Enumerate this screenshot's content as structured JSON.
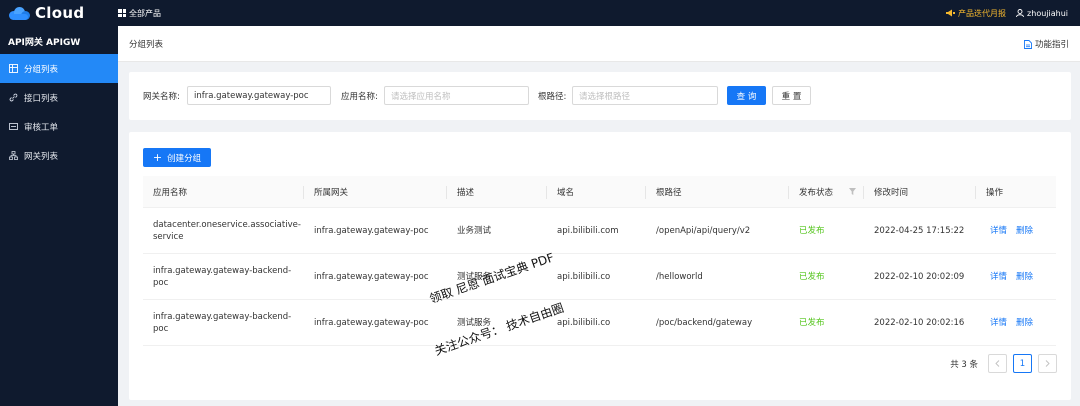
{
  "topbar": {
    "logo_text": "Cloud",
    "all_products": "全部产品",
    "updates_link": "产品迭代月报",
    "username": "zhoujiahui"
  },
  "sidebar": {
    "title": "API网关 APIGW",
    "items": [
      {
        "label": "分组列表",
        "icon": "table-icon",
        "active": true
      },
      {
        "label": "接口列表",
        "icon": "link-icon",
        "active": false
      },
      {
        "label": "审核工单",
        "icon": "ticket-icon",
        "active": false
      },
      {
        "label": "网关列表",
        "icon": "network-icon",
        "active": false
      }
    ]
  },
  "header": {
    "page_title": "分组列表",
    "guide": "功能指引"
  },
  "filters": {
    "gateway_label": "网关名称:",
    "gateway_value": "infra.gateway.gateway-poc",
    "app_label": "应用名称:",
    "app_placeholder": "请选择应用名称",
    "path_label": "根路径:",
    "path_placeholder": "请选择根路径",
    "query_button": "查 询",
    "reset_button": "重 置"
  },
  "table": {
    "create_button": "创建分组",
    "columns": [
      "应用名称",
      "所属网关",
      "描述",
      "域名",
      "根路径",
      "发布状态",
      "修改时间",
      "操作"
    ],
    "rows": [
      {
        "app": "datacenter.oneservice.associative-service",
        "gateway": "infra.gateway.gateway-poc",
        "desc": "业务测试",
        "domain": "api.bilibili.com",
        "path": "/openApi/api/query/v2",
        "status": "已发布",
        "modified": "2022-04-25 17:15:22",
        "detail": "详情",
        "delete": "删除"
      },
      {
        "app": "infra.gateway.gateway-backend-poc",
        "gateway": "infra.gateway.gateway-poc",
        "desc": "测试服务",
        "domain": "api.bilibili.co",
        "path": "/helloworld",
        "status": "已发布",
        "modified": "2022-02-10 20:02:09",
        "detail": "详情",
        "delete": "删除"
      },
      {
        "app": "infra.gateway.gateway-backend-poc",
        "gateway": "infra.gateway.gateway-poc",
        "desc": "测试服务",
        "domain": "api.bilibili.co",
        "path": "/poc/backend/gateway",
        "status": "已发布",
        "modified": "2022-02-10 20:02:16",
        "detail": "详情",
        "delete": "删除"
      }
    ],
    "total_text": "共 3 条",
    "current_page": "1"
  },
  "watermark": {
    "line1": "领取 尼恩 面试宝典 PDF",
    "line2": "关注公众号：  技术自由圈"
  },
  "colors": {
    "nav_bg": "#0f1a2e",
    "primary": "#1677f6",
    "success": "#52c41a",
    "accent_gold": "#f5b82e"
  }
}
